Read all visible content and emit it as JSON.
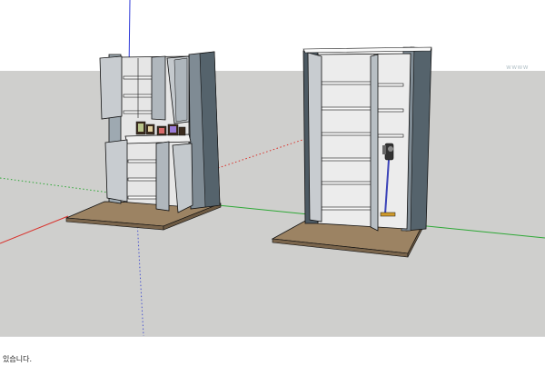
{
  "viewport": {
    "sky_color": "#ffffff",
    "ground_color": "#cfcfcd",
    "axis_colors": {
      "red": "#d9312b",
      "green": "#2ea836",
      "blue": "#2f3ad8"
    },
    "watermark": "wwww"
  },
  "models": [
    {
      "name": "cabinet-with-open-doors",
      "items": [
        "upper-doors",
        "frames-shelf",
        "lower-doors",
        "floor-board"
      ]
    },
    {
      "name": "tall-cabinet-with-vacuum",
      "items": [
        "open-doors",
        "shelves",
        "stick-vacuum",
        "floor-board"
      ]
    }
  ],
  "status_bar": {
    "text": "있습니다."
  }
}
